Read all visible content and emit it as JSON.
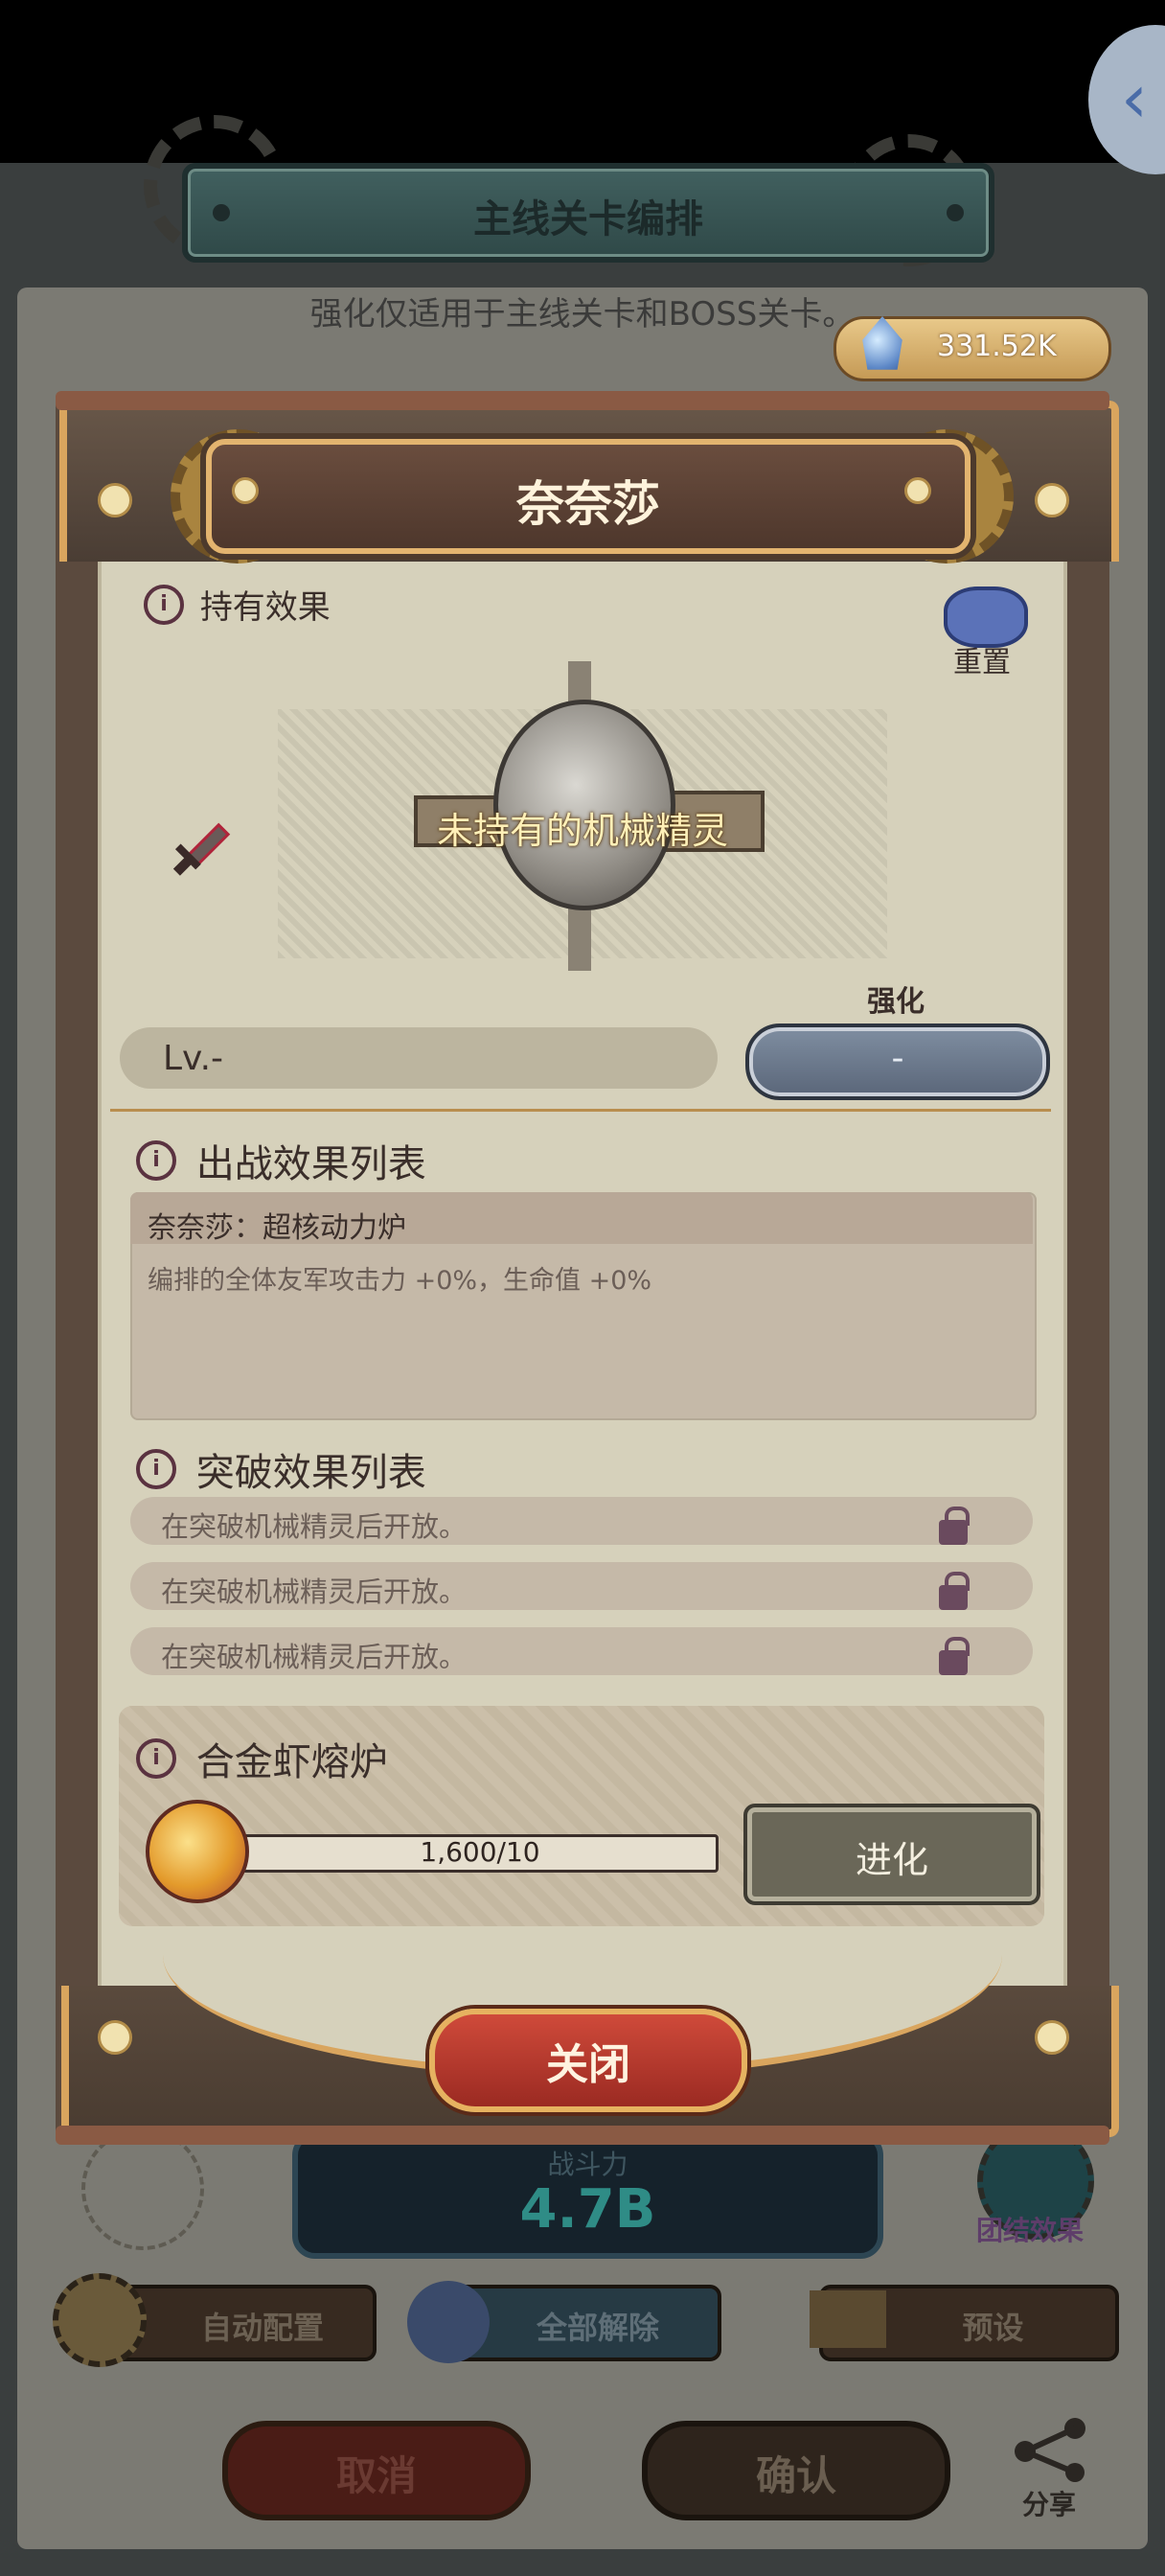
{
  "header": {
    "title": "主线关卡编排"
  },
  "subtitle": "强化仅适用于主线关卡和BOSS关卡。",
  "currency": {
    "icon": "crystal-icon",
    "value": "331.52K"
  },
  "back_icon": "chevron-left-icon",
  "dialog": {
    "title": "奈奈莎",
    "hold_effect_label": "持有效果",
    "reset_label": "重置",
    "unowned_text": "未持有的机械精灵",
    "level_text": "Lv.-",
    "enhance_label": "强化",
    "enhance_value": "-",
    "battle_effects": {
      "title": "出战效果列表",
      "name": "奈奈莎：超核动力炉",
      "desc": "编排的全体友军攻击力 +0%，生命值 +0%"
    },
    "breakthrough_effects": {
      "title": "突破效果列表",
      "rows": [
        "在突破机械精灵后开放。",
        "在突破机械精灵后开放。",
        "在突破机械精灵后开放。"
      ]
    },
    "forge": {
      "title": "合金虾熔炉",
      "progress_text": "1,600/10",
      "progress_fraction": 1.0,
      "evolve_label": "进化"
    },
    "close_label": "关闭"
  },
  "background": {
    "power_label": "战斗力",
    "power_value": "4.7B",
    "tuanjie_label": "团结效果",
    "auto_config": "自动配置",
    "remove_all": "全部解除",
    "preset": "预设",
    "cancel": "取消",
    "confirm": "确认",
    "share": "分享"
  },
  "colors": {
    "accent_gold": "#d9a55e",
    "close_red": "#cf4a3a",
    "power_teal": "#2f8c86"
  }
}
